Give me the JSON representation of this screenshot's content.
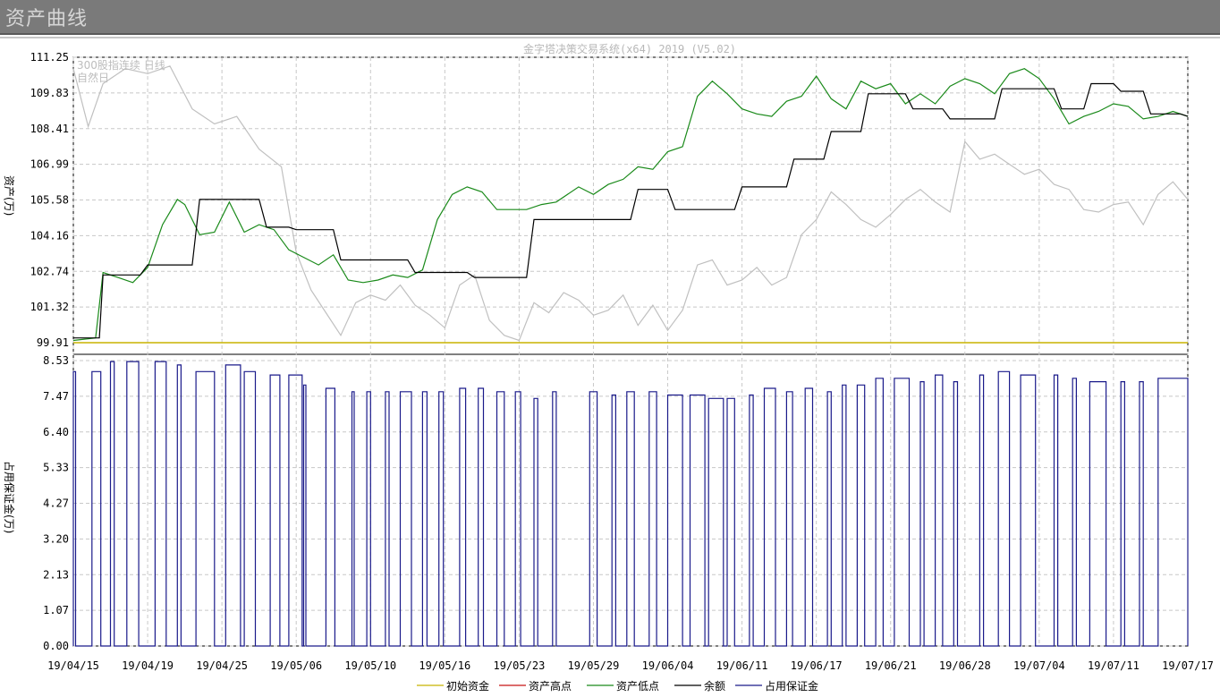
{
  "window": {
    "title": "资产曲线"
  },
  "chart_data": {
    "type": "line",
    "watermark": "金字塔决策交易系统(x64) 2019 (V5.02)",
    "corner_labels": [
      "300股指连续 日线",
      "自然日"
    ],
    "x_tick_labels": [
      "19/04/15",
      "19/04/19",
      "19/04/25",
      "19/05/06",
      "19/05/10",
      "19/05/16",
      "19/05/23",
      "19/05/29",
      "19/06/04",
      "19/06/11",
      "19/06/17",
      "19/06/21",
      "19/06/28",
      "19/07/04",
      "19/07/11",
      "19/07/17"
    ],
    "legend_position": "bottom-center",
    "grid": true,
    "top_panel": {
      "ylabel": "资产(万)",
      "ylim": [
        99.91,
        111.25
      ],
      "y_ticks": [
        "111.25",
        "109.83",
        "108.41",
        "106.99",
        "105.58",
        "104.16",
        "102.74",
        "101.32",
        "99.91"
      ],
      "series": [
        {
          "name": "初始资金",
          "color": "#c8b400",
          "x": [
            0,
            15
          ],
          "values": [
            99.91,
            99.91
          ]
        },
        {
          "name": "余额",
          "color": "#000000",
          "x": [
            0,
            0.35,
            0.4,
            0.9,
            1.0,
            1.6,
            1.7,
            2.5,
            2.6,
            2.9,
            3.0,
            3.5,
            3.6,
            4.5,
            4.6,
            5.3,
            5.4,
            6.1,
            6.2,
            7.5,
            7.6,
            8.0,
            8.1,
            8.9,
            9.0,
            9.6,
            9.7,
            10.1,
            10.2,
            10.6,
            10.7,
            11.2,
            11.3,
            11.7,
            11.8,
            12.4,
            12.5,
            13.2,
            13.3,
            13.6,
            13.7,
            14.0,
            14.1,
            14.4,
            14.5,
            14.9,
            15
          ],
          "values": [
            100.1,
            100.1,
            102.6,
            102.6,
            103.0,
            103.0,
            105.6,
            105.6,
            104.5,
            104.5,
            104.4,
            104.4,
            103.2,
            103.2,
            102.7,
            102.7,
            102.5,
            102.5,
            104.8,
            104.8,
            106.0,
            106.0,
            105.2,
            105.2,
            106.1,
            106.1,
            107.2,
            107.2,
            108.3,
            108.3,
            109.8,
            109.8,
            109.2,
            109.2,
            108.8,
            108.8,
            110.0,
            110.0,
            109.2,
            109.2,
            110.2,
            110.2,
            109.9,
            109.9,
            109.0,
            109.0,
            108.9
          ]
        },
        {
          "name": "资产低点",
          "color": "#1a8a1a",
          "x": [
            0,
            0.3,
            0.4,
            0.6,
            0.8,
            0.9,
            1.0,
            1.2,
            1.4,
            1.5,
            1.7,
            1.9,
            2.1,
            2.3,
            2.5,
            2.7,
            2.9,
            3.1,
            3.3,
            3.5,
            3.7,
            3.9,
            4.1,
            4.3,
            4.5,
            4.7,
            4.9,
            5.1,
            5.3,
            5.5,
            5.7,
            5.9,
            6.1,
            6.3,
            6.5,
            6.8,
            7.0,
            7.2,
            7.4,
            7.6,
            7.8,
            8.0,
            8.2,
            8.4,
            8.6,
            8.8,
            9.0,
            9.2,
            9.4,
            9.6,
            9.8,
            10.0,
            10.2,
            10.4,
            10.6,
            10.8,
            11.0,
            11.2,
            11.4,
            11.6,
            11.8,
            12.0,
            12.2,
            12.4,
            12.6,
            12.8,
            13.0,
            13.2,
            13.4,
            13.6,
            13.8,
            14.0,
            14.2,
            14.4,
            14.6,
            14.8,
            15
          ],
          "values": [
            100.0,
            100.1,
            102.7,
            102.5,
            102.3,
            102.6,
            102.9,
            104.6,
            105.6,
            105.4,
            104.2,
            104.3,
            105.5,
            104.3,
            104.6,
            104.4,
            103.6,
            103.3,
            103.0,
            103.4,
            102.4,
            102.3,
            102.4,
            102.6,
            102.5,
            102.8,
            104.8,
            105.8,
            106.1,
            105.9,
            105.2,
            105.2,
            105.2,
            105.4,
            105.5,
            106.1,
            105.8,
            106.2,
            106.4,
            106.9,
            106.8,
            107.5,
            107.7,
            109.7,
            110.3,
            109.8,
            109.2,
            109.0,
            108.9,
            109.5,
            109.7,
            110.5,
            109.6,
            109.2,
            110.3,
            110.0,
            110.2,
            109.4,
            109.8,
            109.4,
            110.1,
            110.4,
            110.2,
            109.8,
            110.6,
            110.8,
            110.4,
            109.6,
            108.6,
            108.9,
            109.1,
            109.4,
            109.3,
            108.8,
            108.9,
            109.1,
            108.9
          ]
        },
        {
          "name": "300股指连续 日线",
          "color": "#c0c0c0",
          "x": [
            0,
            0.2,
            0.4,
            0.7,
            1.0,
            1.3,
            1.6,
            1.9,
            2.2,
            2.5,
            2.8,
            3.0,
            3.2,
            3.4,
            3.6,
            3.8,
            4.0,
            4.2,
            4.4,
            4.6,
            4.8,
            5.0,
            5.2,
            5.4,
            5.6,
            5.8,
            6.0,
            6.2,
            6.4,
            6.6,
            6.8,
            7.0,
            7.2,
            7.4,
            7.6,
            7.8,
            8.0,
            8.2,
            8.4,
            8.6,
            8.8,
            9.0,
            9.2,
            9.4,
            9.6,
            9.8,
            10.0,
            10.2,
            10.4,
            10.6,
            10.8,
            11.0,
            11.2,
            11.4,
            11.6,
            11.8,
            12.0,
            12.2,
            12.4,
            12.6,
            12.8,
            13.0,
            13.2,
            13.4,
            13.6,
            13.8,
            14.0,
            14.2,
            14.4,
            14.6,
            14.8,
            15
          ],
          "values": [
            110.8,
            108.5,
            110.2,
            110.8,
            110.6,
            110.9,
            109.2,
            108.6,
            108.9,
            107.6,
            106.9,
            103.5,
            102.0,
            101.1,
            100.2,
            101.5,
            101.8,
            101.6,
            102.2,
            101.4,
            101.0,
            100.5,
            102.2,
            102.6,
            100.8,
            100.2,
            100.0,
            101.5,
            101.1,
            101.9,
            101.6,
            101.0,
            101.2,
            101.8,
            100.6,
            101.4,
            100.4,
            101.2,
            103.0,
            103.2,
            102.2,
            102.4,
            102.9,
            102.2,
            102.5,
            104.2,
            104.8,
            105.9,
            105.4,
            104.8,
            104.5,
            105.0,
            105.6,
            106.0,
            105.5,
            105.1,
            107.9,
            107.2,
            107.4,
            107.0,
            106.6,
            106.8,
            106.2,
            106.0,
            105.2,
            105.1,
            105.4,
            105.5,
            104.6,
            105.8,
            106.3,
            105.6
          ]
        }
      ]
    },
    "bottom_panel": {
      "ylabel": "占用保证金(万)",
      "ylim": [
        0,
        8.53
      ],
      "y_ticks": [
        "8.53",
        "7.47",
        "6.40",
        "5.33",
        "4.27",
        "3.20",
        "2.13",
        "1.07",
        "0.00"
      ],
      "series": [
        {
          "name": "占用保证金",
          "color": "#1a1a8a",
          "blocks": [
            [
              0.0,
              0.03,
              8.2
            ],
            [
              0.25,
              0.37,
              8.2
            ],
            [
              0.5,
              0.55,
              8.5
            ],
            [
              0.72,
              0.88,
              8.5
            ],
            [
              1.1,
              1.25,
              8.5
            ],
            [
              1.4,
              1.45,
              8.4
            ],
            [
              1.65,
              1.9,
              8.2
            ],
            [
              2.05,
              2.25,
              8.4
            ],
            [
              2.3,
              2.45,
              8.2
            ],
            [
              2.65,
              2.78,
              8.1
            ],
            [
              2.9,
              3.08,
              8.1
            ],
            [
              3.1,
              3.13,
              7.8
            ],
            [
              3.4,
              3.52,
              7.7
            ],
            [
              3.75,
              3.78,
              7.6
            ],
            [
              3.95,
              4.0,
              7.6
            ],
            [
              4.2,
              4.25,
              7.6
            ],
            [
              4.4,
              4.55,
              7.6
            ],
            [
              4.7,
              4.76,
              7.6
            ],
            [
              4.92,
              4.98,
              7.6
            ],
            [
              5.2,
              5.28,
              7.7
            ],
            [
              5.45,
              5.52,
              7.7
            ],
            [
              5.7,
              5.8,
              7.6
            ],
            [
              5.95,
              6.02,
              7.6
            ],
            [
              6.2,
              6.25,
              7.4
            ],
            [
              6.45,
              6.5,
              7.6
            ],
            [
              6.95,
              7.05,
              7.6
            ],
            [
              7.25,
              7.3,
              7.5
            ],
            [
              7.45,
              7.55,
              7.6
            ],
            [
              7.75,
              7.85,
              7.6
            ],
            [
              8.0,
              8.2,
              7.5
            ],
            [
              8.3,
              8.5,
              7.5
            ],
            [
              8.55,
              8.75,
              7.4
            ],
            [
              8.8,
              8.9,
              7.4
            ],
            [
              9.1,
              9.15,
              7.5
            ],
            [
              9.3,
              9.45,
              7.7
            ],
            [
              9.6,
              9.68,
              7.6
            ],
            [
              9.85,
              9.95,
              7.7
            ],
            [
              10.15,
              10.2,
              7.6
            ],
            [
              10.35,
              10.4,
              7.8
            ],
            [
              10.55,
              10.65,
              7.8
            ],
            [
              10.8,
              10.9,
              8.0
            ],
            [
              11.05,
              11.25,
              8.0
            ],
            [
              11.4,
              11.45,
              7.9
            ],
            [
              11.6,
              11.7,
              8.1
            ],
            [
              11.85,
              11.9,
              7.9
            ],
            [
              12.2,
              12.25,
              8.1
            ],
            [
              12.45,
              12.6,
              8.2
            ],
            [
              12.75,
              12.95,
              8.1
            ],
            [
              13.2,
              13.25,
              8.1
            ],
            [
              13.45,
              13.5,
              8.0
            ],
            [
              13.68,
              13.9,
              7.9
            ],
            [
              14.1,
              14.15,
              7.9
            ],
            [
              14.35,
              14.4,
              7.9
            ],
            [
              14.6,
              15.0,
              8.0
            ]
          ]
        }
      ]
    }
  }
}
